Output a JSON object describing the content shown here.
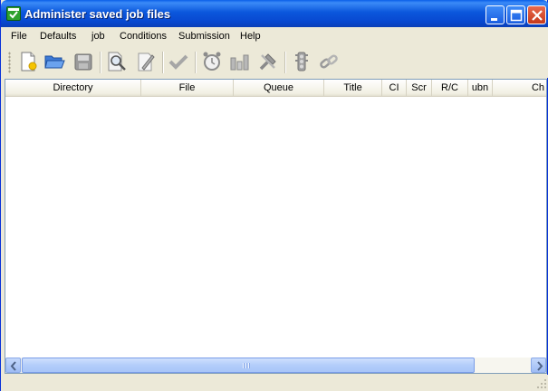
{
  "window": {
    "title": "Administer saved job files",
    "app_icon": "calendar-check-icon",
    "controls": {
      "minimize": "minimize-icon",
      "maximize": "maximize-icon",
      "close": "close-icon"
    }
  },
  "menu": {
    "items": [
      "File",
      "Defaults",
      "job",
      "Conditions",
      "Submission",
      "Help"
    ]
  },
  "toolbar": {
    "icons": [
      "new-file-icon",
      "open-folder-icon",
      "save-icon",
      "search-icon",
      "edit-icon",
      "check-icon",
      "alarm-clock-icon",
      "bar-chart-icon",
      "tools-icon",
      "traffic-light-icon",
      "link-icon"
    ]
  },
  "table": {
    "columns": [
      "Directory",
      "File",
      "Queue",
      "Title",
      "CI",
      "Scr",
      "R/C",
      "ubn",
      "Ch"
    ],
    "rows": []
  },
  "scrollbar": {
    "left": "scroll-left-icon",
    "right": "scroll-right-icon"
  }
}
